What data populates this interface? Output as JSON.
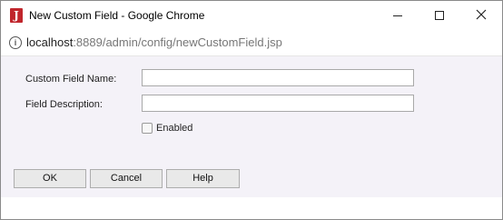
{
  "window": {
    "title": "New Custom Field - Google Chrome",
    "app_icon_letter": "J",
    "accent_color": "#c0262c"
  },
  "address_bar": {
    "url_host": "localhost",
    "url_rest": ":8889/admin/config/newCustomField.jsp",
    "icon": "info-icon"
  },
  "form": {
    "name_label": "Custom Field Name:",
    "name_value": "",
    "description_label": "Field Description:",
    "description_value": "",
    "enabled_label": "Enabled",
    "enabled_checked": false
  },
  "buttons": {
    "ok_label": "OK",
    "cancel_label": "Cancel",
    "help_label": "Help"
  },
  "colors": {
    "content_background": "#f4f2f8",
    "button_background": "#e9e9e9"
  }
}
